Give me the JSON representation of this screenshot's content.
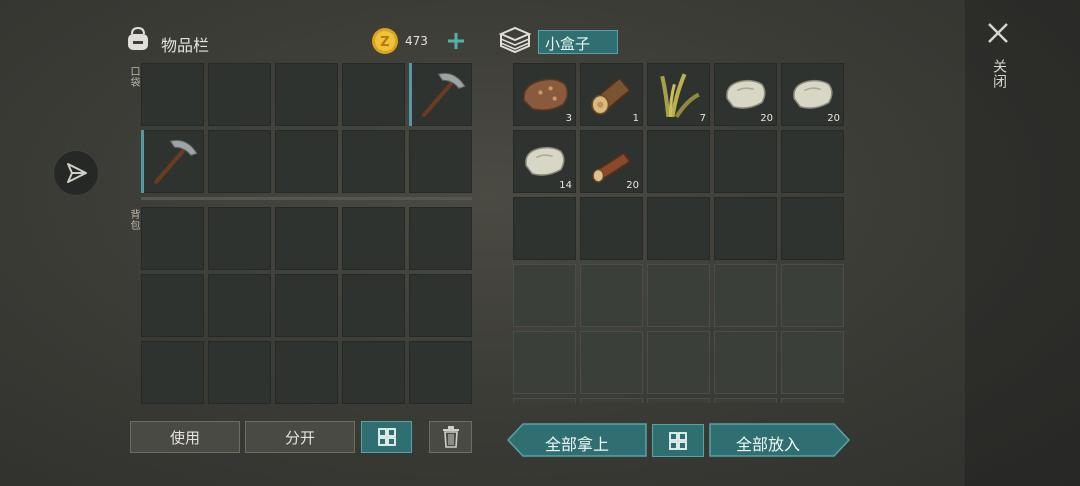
{
  "inventory": {
    "title": "物品栏",
    "coins": "473",
    "pocket_label": "口袋",
    "backpack_label": "背包",
    "pocket_slots": [
      {
        "item": "",
        "qty": ""
      },
      {
        "item": "",
        "qty": ""
      },
      {
        "item": "",
        "qty": ""
      },
      {
        "item": "",
        "qty": ""
      },
      {
        "item": "pickaxe-icon",
        "qty": "",
        "selected": true
      },
      {
        "item": "pickaxe-icon",
        "qty": "",
        "selected": true
      },
      {
        "item": "",
        "qty": ""
      },
      {
        "item": "",
        "qty": ""
      },
      {
        "item": "",
        "qty": ""
      },
      {
        "item": "",
        "qty": ""
      }
    ],
    "buttons": {
      "use": "使用",
      "split": "分开"
    }
  },
  "container": {
    "title": "小盒子",
    "slots": [
      {
        "item": "ore-icon",
        "qty": "3"
      },
      {
        "item": "log-icon",
        "qty": "1"
      },
      {
        "item": "plant-fiber-icon",
        "qty": "7"
      },
      {
        "item": "stone-icon",
        "qty": "20"
      },
      {
        "item": "stone-icon",
        "qty": "20"
      },
      {
        "item": "stone-icon",
        "qty": "14"
      },
      {
        "item": "branch-icon",
        "qty": "20"
      }
    ],
    "buttons": {
      "take_all": "全部拿上",
      "put_all": "全部放入"
    }
  },
  "close_label": "关闭",
  "colors": {
    "accent": "#2f6f72",
    "slot_bg": "#2f3330",
    "selection": "#4f9aa4"
  }
}
